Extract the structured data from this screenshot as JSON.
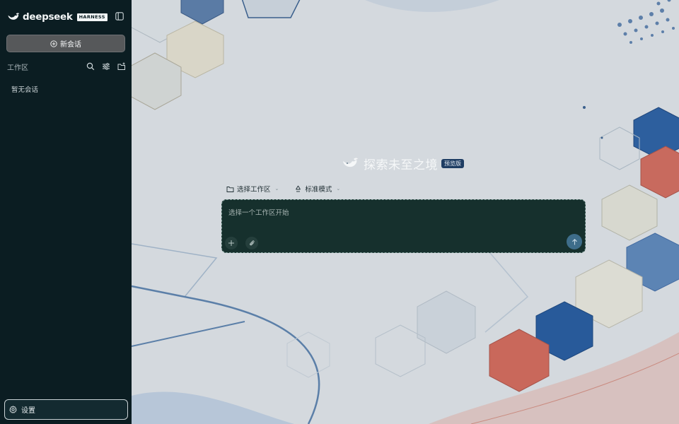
{
  "brand": {
    "name": "deepseek",
    "badge": "HARNESS"
  },
  "sidebar": {
    "new_chat_label": "新会话",
    "workspace_title": "工作区",
    "empty_note": "暂无会话",
    "settings_label": "设置"
  },
  "main": {
    "hero_title": "探索未至之境",
    "hero_badge": "预览版",
    "workspace_select_label": "选择工作区",
    "mode_label": "标准模式",
    "composer_placeholder": "选择一个工作区开始"
  },
  "icons": {
    "brand": "whale-logo-icon",
    "collapse": "sidebar-toggle-icon",
    "new_chat": "plus-circle-icon",
    "search": "search-icon",
    "filter": "sliders-icon",
    "new_folder": "folder-plus-icon",
    "settings": "gear-icon",
    "folder": "folder-icon",
    "mode": "recycle-icon",
    "add": "plus-icon",
    "attach": "paperclip-icon",
    "send": "arrow-up-icon"
  },
  "colors": {
    "sidebar_bg": "#0b1d22",
    "composer_bg": "#16302d",
    "send_button": "#3e6d8a",
    "accent_blue": "#2d5f9e",
    "accent_red": "#c86a5e"
  }
}
